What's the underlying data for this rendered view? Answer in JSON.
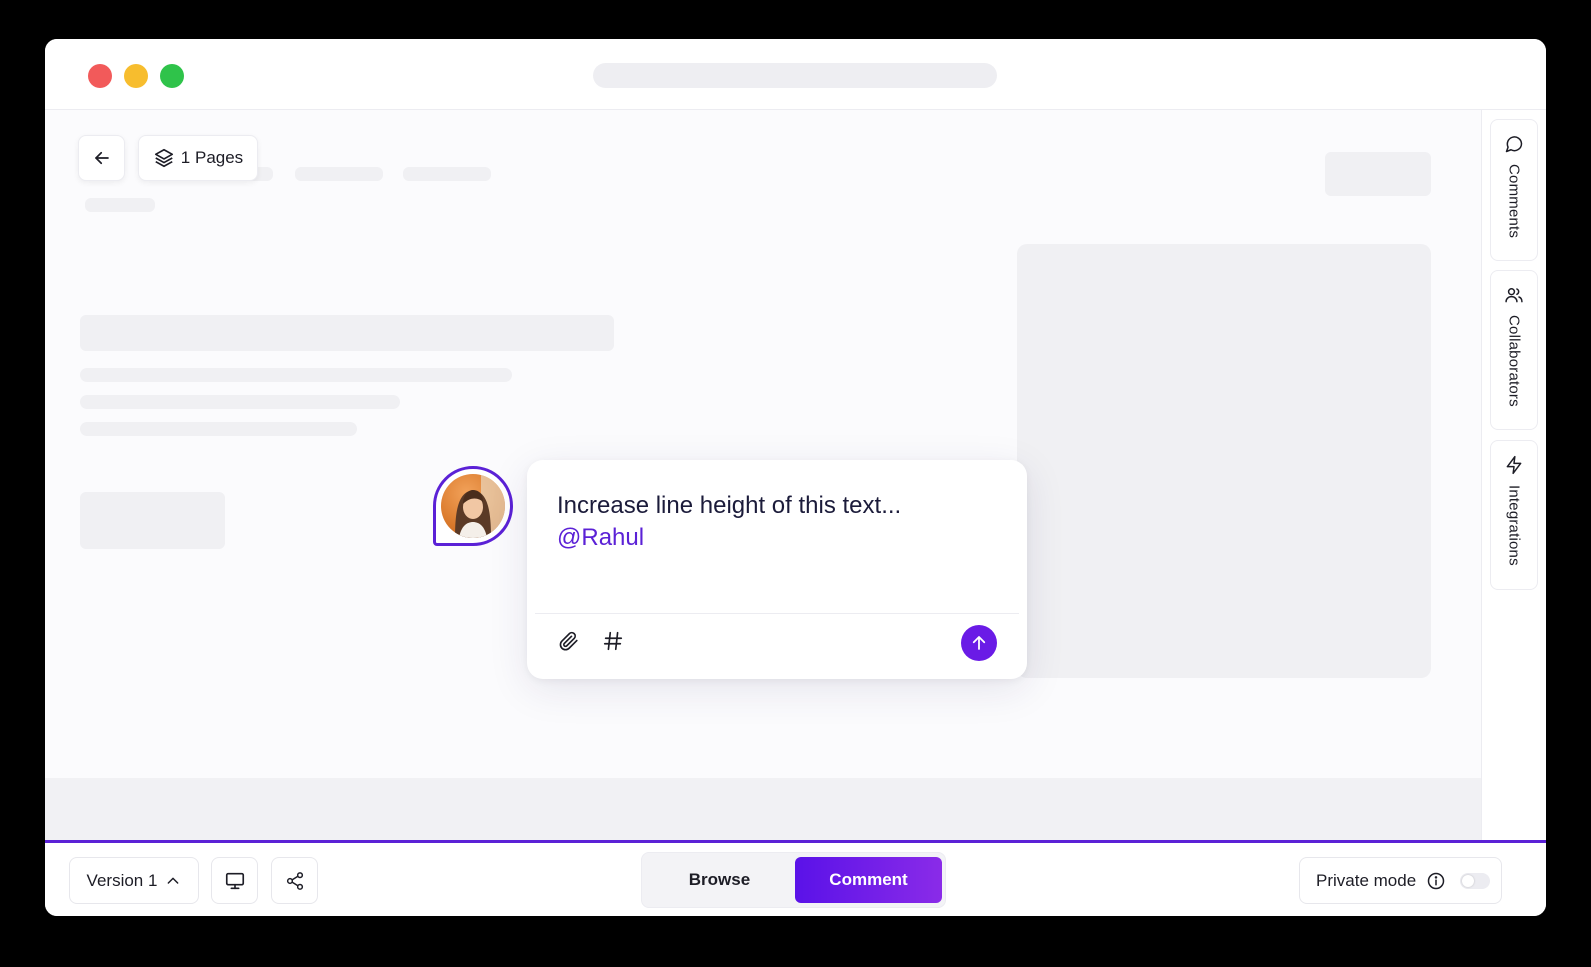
{
  "window": {
    "title_placeholder": ""
  },
  "toolbar": {
    "pages_label": "1 Pages"
  },
  "right_rail": {
    "tabs": [
      {
        "label": "Comments",
        "icon": "message-circle-icon"
      },
      {
        "label": "Collaborators",
        "icon": "users-icon"
      },
      {
        "label": "Integrations",
        "icon": "lightning-icon"
      }
    ]
  },
  "comment": {
    "text": "Increase line height of this text...",
    "mention": "@Rahul",
    "attach_icon": "paperclip-icon",
    "hashtag_icon": "hashtag-icon",
    "send_icon": "arrow-up-icon"
  },
  "bottom_bar": {
    "version_label": "Version 1",
    "modes": {
      "browse": "Browse",
      "comment": "Comment",
      "active": "comment"
    },
    "private_mode_label": "Private mode",
    "private_mode_enabled": false
  },
  "colors": {
    "accent": "#5b21d6",
    "send_button": "#6a1be6",
    "traffic_red": "#f25a5a",
    "traffic_yellow": "#f7bd2e",
    "traffic_green": "#2fc34a"
  }
}
